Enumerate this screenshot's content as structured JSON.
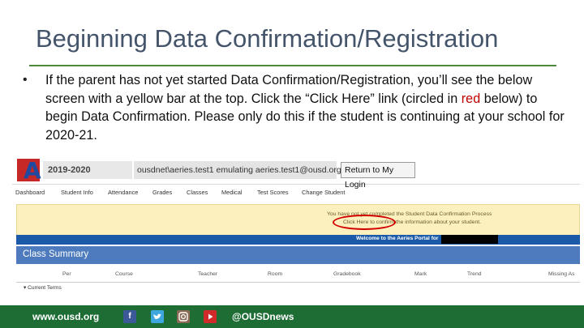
{
  "slide": {
    "title": "Beginning Data Confirmation/Registration",
    "bullet": "•",
    "body_pre": "If the parent has not yet started Data Confirmation/Registration, you’ll see the below screen with a yellow bar at the top. Click the “Click Here” link (circled in ",
    "body_red": "red",
    "body_post": " below) to begin Data Confirmation. Please only do this if the student is continuing at your school for 2020-21.",
    "accent_color": "#c00000",
    "rule_color": "#4d8a3a"
  },
  "aeries": {
    "logo_letter": "A",
    "year": "2019-2020",
    "user": "ousdnet\\aeries.test1 emulating aeries.test1@ousd.org",
    "return_label": "Return to My Login",
    "nav": [
      "Dashboard",
      "Student Info",
      "Attendance",
      "Grades",
      "Classes",
      "Medical",
      "Test Scores",
      "Change Student"
    ],
    "notice_line1": "You have not yet completed the Student Data Confirmation Process",
    "notice_line2": "Click Here to confirm the information about your student.",
    "welcome": "Welcome to the Aeries Portal for",
    "summary_title": "Class Summary",
    "columns": [
      "Per",
      "Course",
      "Teacher",
      "Room",
      "Gradebook",
      "Mark",
      "Trend",
      "Missing As"
    ],
    "current_terms": "▾ Current Terms"
  },
  "footer": {
    "url": "www.ousd.org",
    "handle": "@OUSDnews",
    "icons": [
      "facebook-icon",
      "twitter-icon",
      "instagram-icon",
      "youtube-icon"
    ],
    "color": "#1e6d35"
  }
}
